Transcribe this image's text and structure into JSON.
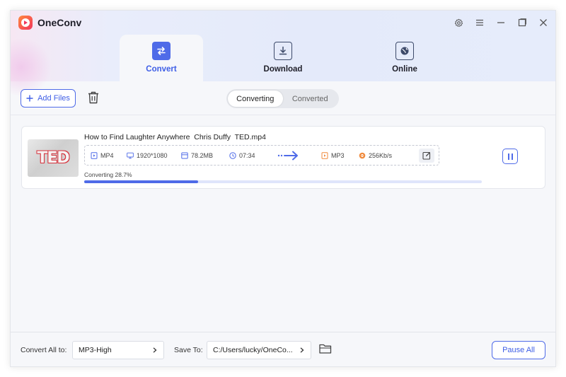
{
  "app": {
    "title": "OneConv"
  },
  "window_controls": [
    "gear-icon",
    "menu-icon",
    "minimize-icon",
    "maximize-icon",
    "close-icon"
  ],
  "tabs": [
    {
      "label": "Convert",
      "icon": "convert-icon",
      "active": true
    },
    {
      "label": "Download",
      "icon": "download-icon",
      "active": false
    },
    {
      "label": "Online",
      "icon": "globe-icon",
      "active": false
    }
  ],
  "toolbar": {
    "add_files_label": "Add Files",
    "segments": [
      {
        "label": "Converting",
        "active": true
      },
      {
        "label": "Converted",
        "active": false
      }
    ]
  },
  "task": {
    "thumbnail_text": "TED",
    "filename": "How to Find Laughter Anywhere  Chris Duffy  TED.mp4",
    "source": {
      "format": "MP4",
      "resolution": "1920*1080",
      "size": "78.2MB",
      "duration": "07:34"
    },
    "target": {
      "format": "MP3",
      "bitrate": "256Kb/s"
    },
    "progress_text": "Converting 28.7%",
    "progress": 0.287
  },
  "footer": {
    "convert_all_label": "Convert All to:",
    "convert_all_value": "MP3-High",
    "save_to_label": "Save To:",
    "save_to_value": "C:/Users/lucky/OneCo...",
    "pause_all_label": "Pause All"
  },
  "colors": {
    "accent": "#4f6be8",
    "accent_text": "#3e5ee6",
    "bitrate_icon": "#f08a3c",
    "brand_gradient": [
      "#ff8a3d",
      "#f2345c"
    ]
  }
}
